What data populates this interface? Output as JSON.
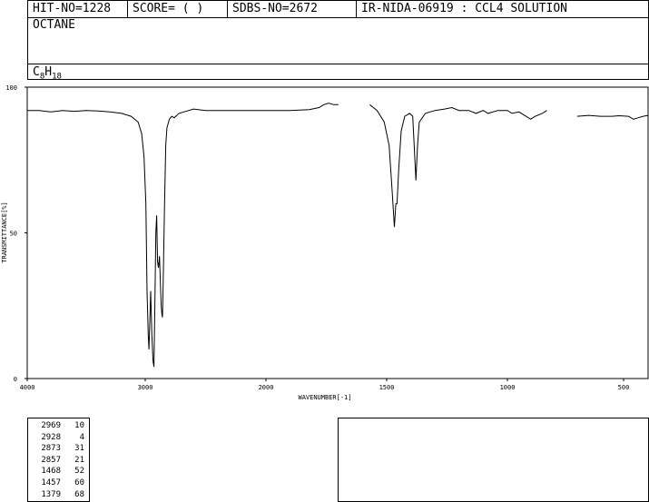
{
  "header": {
    "hit_no": "HIT-NO=1228",
    "score": "SCORE=  (  )",
    "sdbs_no": "SDBS-NO=2672",
    "source": "IR-NIDA-06919 : CCL4 SOLUTION",
    "compound": "OCTANE",
    "formula_main": "C",
    "formula_sub1": "8",
    "formula_mid": "H",
    "formula_sub2": "18"
  },
  "chart_data": {
    "type": "line",
    "xlabel": "WAVENUMBER[-1]",
    "ylabel": "TRANSMITTANCE[%]",
    "xlim": [
      4000,
      400
    ],
    "ylim": [
      0,
      100
    ],
    "x_ticks": [
      4000,
      3000,
      2000,
      1500,
      1000,
      500
    ],
    "y_ticks": [
      0,
      50,
      100
    ],
    "segments": [
      [
        [
          4000,
          92
        ],
        [
          3900,
          92
        ],
        [
          3800,
          91.5
        ],
        [
          3700,
          92
        ],
        [
          3600,
          91.7
        ],
        [
          3500,
          92
        ],
        [
          3400,
          91.8
        ],
        [
          3300,
          91.5
        ],
        [
          3200,
          91
        ],
        [
          3120,
          90
        ],
        [
          3060,
          88
        ],
        [
          3030,
          84
        ],
        [
          3010,
          76
        ],
        [
          2995,
          60
        ],
        [
          2985,
          30
        ],
        [
          2975,
          15
        ],
        [
          2969,
          10
        ],
        [
          2962,
          20
        ],
        [
          2955,
          30
        ],
        [
          2945,
          15
        ],
        [
          2935,
          6
        ],
        [
          2928,
          4
        ],
        [
          2920,
          25
        ],
        [
          2912,
          50
        ],
        [
          2905,
          56
        ],
        [
          2898,
          40
        ],
        [
          2890,
          38
        ],
        [
          2882,
          42
        ],
        [
          2873,
          31
        ],
        [
          2868,
          25
        ],
        [
          2862,
          22
        ],
        [
          2857,
          21
        ],
        [
          2850,
          35
        ],
        [
          2840,
          60
        ],
        [
          2830,
          80
        ],
        [
          2820,
          86
        ],
        [
          2800,
          89
        ],
        [
          2780,
          90
        ],
        [
          2760,
          89.5
        ],
        [
          2720,
          91
        ],
        [
          2680,
          91.5
        ],
        [
          2600,
          92.5
        ],
        [
          2500,
          92
        ],
        [
          2400,
          92
        ],
        [
          2200,
          92
        ],
        [
          2000,
          92
        ],
        [
          1900,
          92
        ],
        [
          1820,
          92.3
        ],
        [
          1780,
          93
        ],
        [
          1760,
          94
        ],
        [
          1740,
          94.5
        ],
        [
          1720,
          94
        ],
        [
          1700,
          94
        ]
      ],
      [
        [
          1570,
          94
        ],
        [
          1540,
          92
        ],
        [
          1510,
          88
        ],
        [
          1490,
          80
        ],
        [
          1478,
          65
        ],
        [
          1468,
          52
        ],
        [
          1462,
          60
        ],
        [
          1457,
          60
        ],
        [
          1450,
          72
        ],
        [
          1440,
          85
        ],
        [
          1425,
          90
        ],
        [
          1405,
          91
        ],
        [
          1392,
          90
        ],
        [
          1386,
          80
        ],
        [
          1379,
          68
        ],
        [
          1372,
          80
        ],
        [
          1365,
          88
        ],
        [
          1340,
          91
        ],
        [
          1300,
          92
        ],
        [
          1260,
          92.5
        ],
        [
          1230,
          93
        ],
        [
          1200,
          92
        ],
        [
          1160,
          92
        ],
        [
          1130,
          91
        ],
        [
          1100,
          92
        ],
        [
          1080,
          91
        ],
        [
          1040,
          92
        ],
        [
          1000,
          92
        ],
        [
          980,
          91
        ],
        [
          950,
          91.5
        ],
        [
          920,
          90
        ],
        [
          900,
          89
        ],
        [
          880,
          90
        ],
        [
          850,
          91
        ],
        [
          830,
          92
        ]
      ],
      [
        [
          700,
          90
        ],
        [
          650,
          90.3
        ],
        [
          600,
          90
        ],
        [
          550,
          90
        ],
        [
          520,
          90.2
        ],
        [
          480,
          90
        ],
        [
          460,
          89
        ],
        [
          440,
          89.5
        ],
        [
          420,
          90
        ],
        [
          400,
          90.3
        ]
      ]
    ]
  },
  "peak_table": [
    {
      "wavenumber": "2969",
      "transmittance": "10"
    },
    {
      "wavenumber": "2928",
      "transmittance": "4"
    },
    {
      "wavenumber": "2873",
      "transmittance": "31"
    },
    {
      "wavenumber": "2857",
      "transmittance": "21"
    },
    {
      "wavenumber": "1468",
      "transmittance": "52"
    },
    {
      "wavenumber": "1457",
      "transmittance": "60"
    },
    {
      "wavenumber": "1379",
      "transmittance": "68"
    }
  ]
}
